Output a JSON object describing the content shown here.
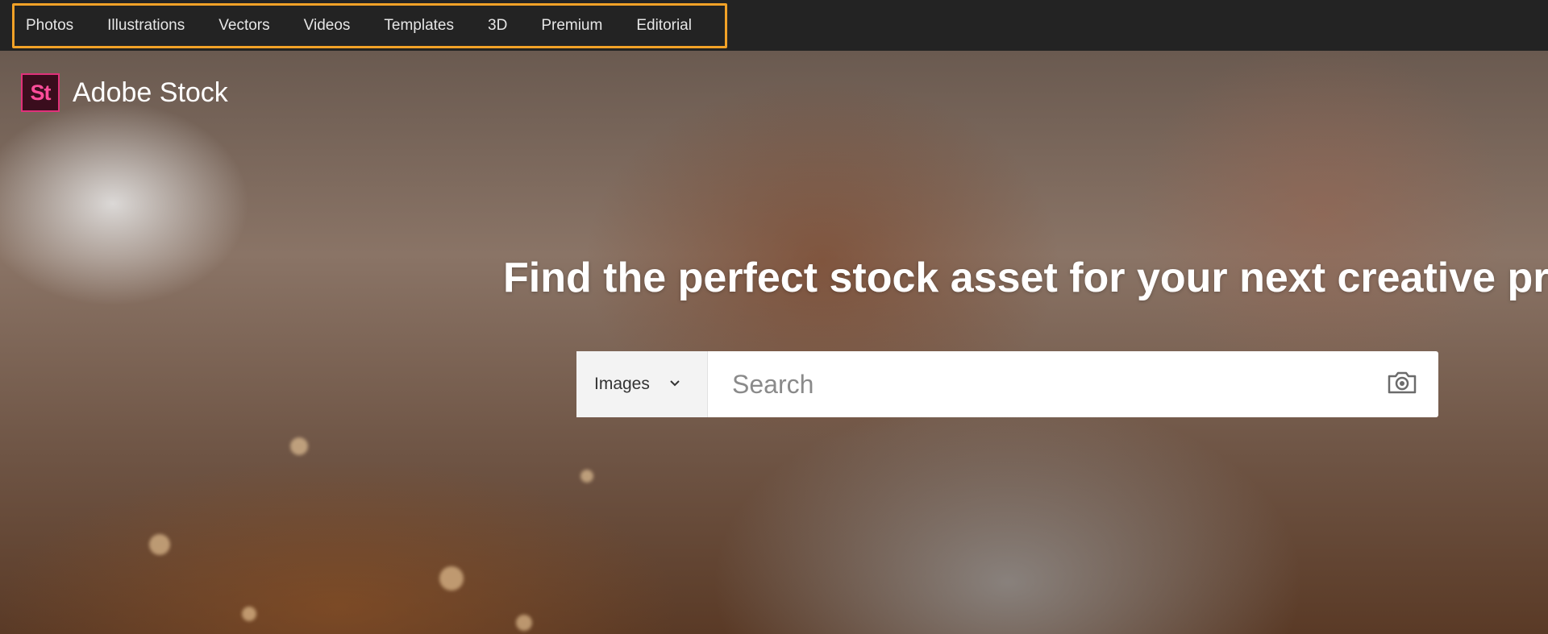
{
  "nav": {
    "items": [
      {
        "label": "Photos"
      },
      {
        "label": "Illustrations"
      },
      {
        "label": "Vectors"
      },
      {
        "label": "Videos"
      },
      {
        "label": "Templates"
      },
      {
        "label": "3D"
      },
      {
        "label": "Premium"
      },
      {
        "label": "Editorial"
      }
    ]
  },
  "brand": {
    "logo_text": "St",
    "name": "Adobe Stock"
  },
  "hero": {
    "headline": "Find the perfect stock asset for your next creative project"
  },
  "search": {
    "type_label": "Images",
    "placeholder": "Search",
    "value": ""
  },
  "colors": {
    "nav_highlight": "#f2a227",
    "brand_accent": "#e0317a"
  },
  "icons": {
    "dropdown": "chevron-down-icon",
    "visual_search": "camera-icon"
  }
}
